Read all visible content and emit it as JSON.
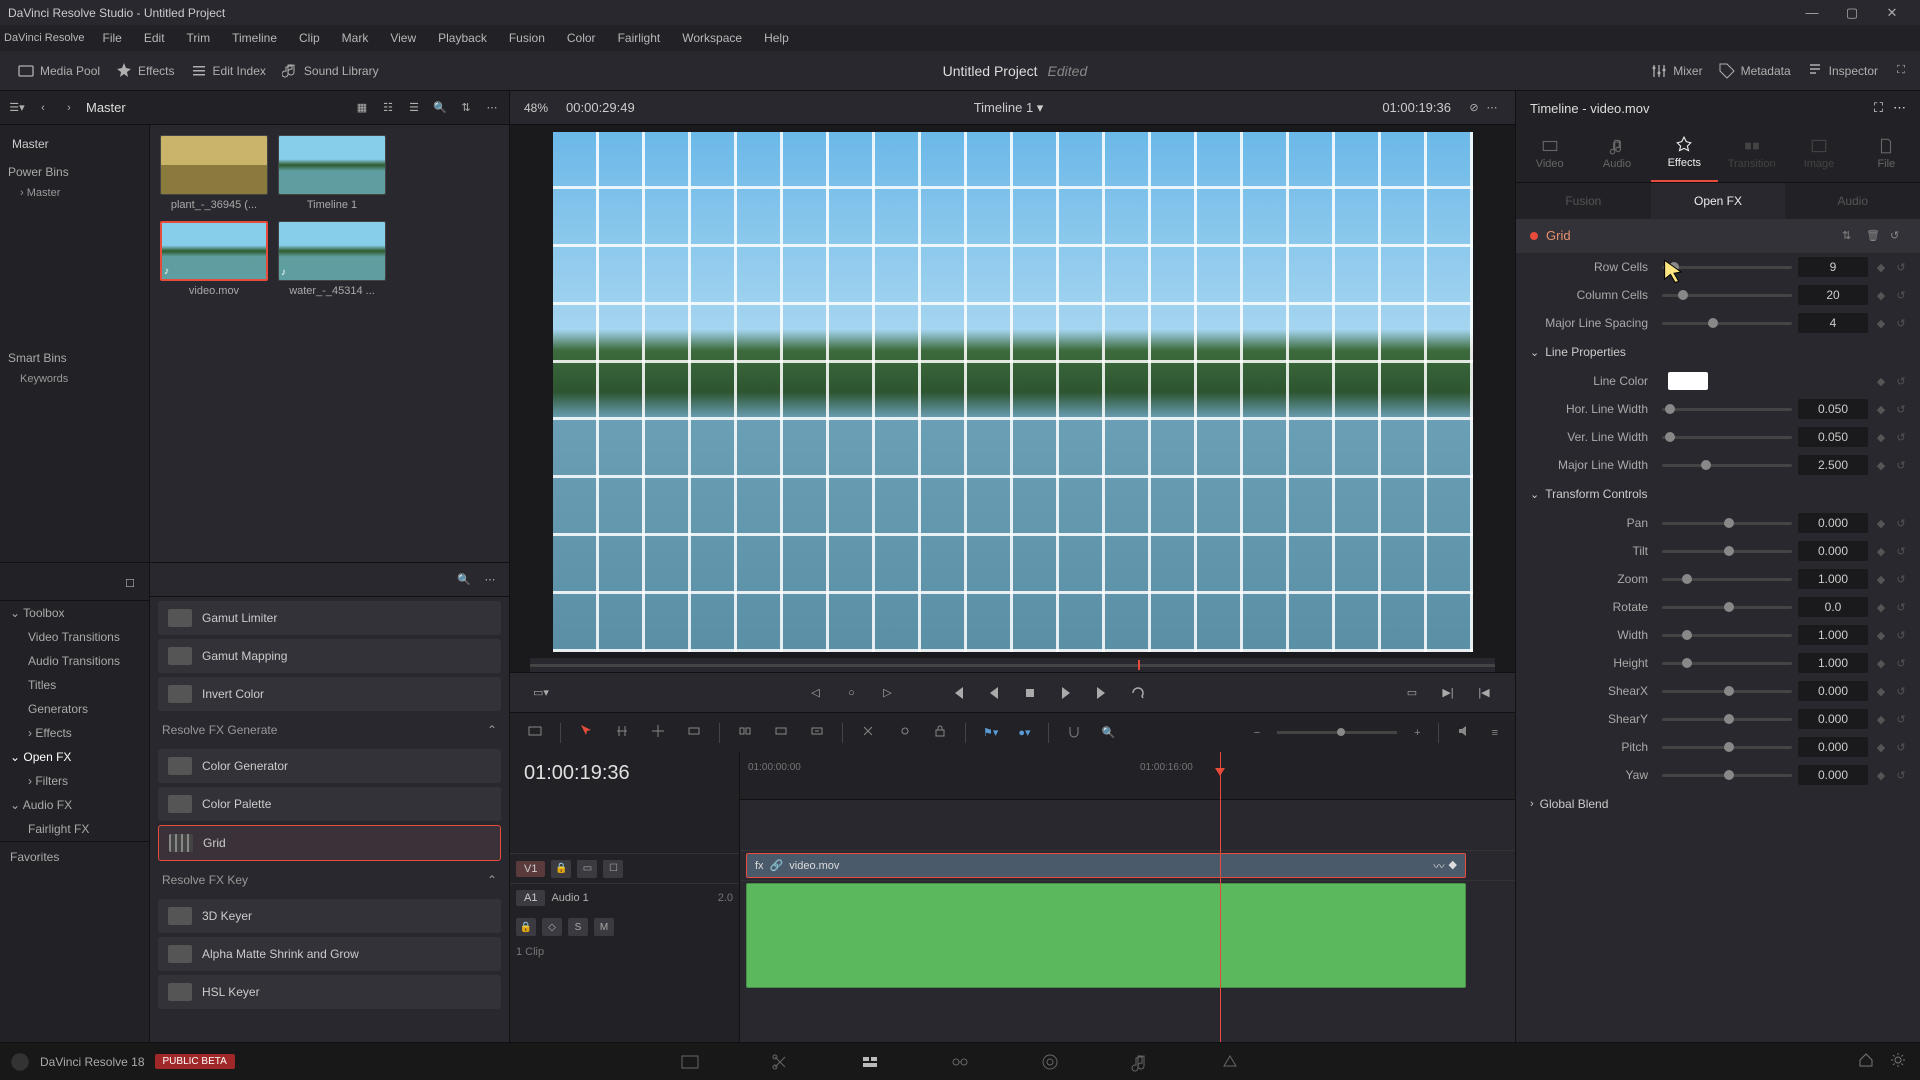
{
  "titlebar": "DaVinci Resolve Studio - Untitled Project",
  "menubar": [
    "File",
    "Edit",
    "Trim",
    "Timeline",
    "Clip",
    "Mark",
    "View",
    "Playback",
    "Fusion",
    "Color",
    "Fairlight",
    "Workspace",
    "Help"
  ],
  "toolbar": {
    "media_pool": "Media Pool",
    "effects": "Effects",
    "edit_index": "Edit Index",
    "sound_lib": "Sound Library",
    "project": "Untitled Project",
    "edited": "Edited",
    "mixer": "Mixer",
    "metadata": "Metadata",
    "inspector": "Inspector"
  },
  "media_hdr": {
    "master": "Master",
    "zoom": "48%",
    "tc_in": "00:00:29:49",
    "tl_name": "Timeline 1",
    "tc_pos": "01:00:19:36"
  },
  "media_tree": {
    "master": "Master",
    "power_bins": "Power Bins",
    "pb_master": "Master",
    "smart_bins": "Smart Bins",
    "keywords": "Keywords"
  },
  "clips": [
    {
      "label": "plant_-_36945 (...",
      "thumb": "grass"
    },
    {
      "label": "Timeline 1",
      "thumb": "island"
    },
    {
      "label": "video.mov",
      "thumb": "island",
      "active": true,
      "aud": true
    },
    {
      "label": "water_-_45314 ...",
      "thumb": "island",
      "aud": true
    }
  ],
  "fx_tree": {
    "toolbox": "Toolbox",
    "video_trans": "Video Transitions",
    "audio_trans": "Audio Transitions",
    "titles": "Titles",
    "generators": "Generators",
    "effects": "Effects",
    "openfx": "Open FX",
    "filters": "Filters",
    "audiofx": "Audio FX",
    "fairlight": "Fairlight FX",
    "favorites": "Favorites"
  },
  "fx_groups": {
    "generate": "Resolve FX Generate",
    "key": "Resolve FX Key"
  },
  "fx_items": {
    "gamut_limiter": "Gamut Limiter",
    "gamut_mapping": "Gamut Mapping",
    "invert_color": "Invert Color",
    "color_gen": "Color Generator",
    "color_palette": "Color Palette",
    "grid": "Grid",
    "keyer3d": "3D Keyer",
    "alpha_matte": "Alpha Matte Shrink and Grow",
    "hsl_keyer": "HSL Keyer"
  },
  "timeline": {
    "tc": "01:00:19:36",
    "ruler": [
      "01:00:00:00",
      "01:00:16:00"
    ],
    "v1": "V1",
    "a1": "A1",
    "audio_name": "Audio 1",
    "audio_fmt": "2.0",
    "clip_ct": "1 Clip",
    "clip_name": "video.mov",
    "s": "S",
    "m": "M"
  },
  "inspector": {
    "title": "Timeline - video.mov",
    "tabs": {
      "video": "Video",
      "audio": "Audio",
      "effects": "Effects",
      "transition": "Transition",
      "image": "Image",
      "file": "File"
    },
    "subtabs": {
      "fusion": "Fusion",
      "openfx": "Open FX",
      "audio": "Audio"
    },
    "fx_name": "Grid",
    "sections": {
      "line": "Line Properties",
      "transform": "Transform Controls",
      "blend": "Global Blend"
    },
    "params": {
      "row_cells": {
        "label": "Row Cells",
        "val": "9"
      },
      "col_cells": {
        "label": "Column Cells",
        "val": "20"
      },
      "major_spacing": {
        "label": "Major Line Spacing",
        "val": "4"
      },
      "line_color": {
        "label": "Line Color"
      },
      "hor_lw": {
        "label": "Hor. Line Width",
        "val": "0.050"
      },
      "ver_lw": {
        "label": "Ver. Line Width",
        "val": "0.050"
      },
      "major_lw": {
        "label": "Major Line Width",
        "val": "2.500"
      },
      "pan": {
        "label": "Pan",
        "val": "0.000"
      },
      "tilt": {
        "label": "Tilt",
        "val": "0.000"
      },
      "zoom": {
        "label": "Zoom",
        "val": "1.000"
      },
      "rotate": {
        "label": "Rotate",
        "val": "0.0"
      },
      "width": {
        "label": "Width",
        "val": "1.000"
      },
      "height": {
        "label": "Height",
        "val": "1.000"
      },
      "shearx": {
        "label": "ShearX",
        "val": "0.000"
      },
      "sheary": {
        "label": "ShearY",
        "val": "0.000"
      },
      "pitch": {
        "label": "Pitch",
        "val": "0.000"
      },
      "yaw": {
        "label": "Yaw",
        "val": "0.000"
      }
    }
  },
  "app": {
    "name": "DaVinci Resolve 18",
    "beta": "PUBLIC BETA"
  }
}
